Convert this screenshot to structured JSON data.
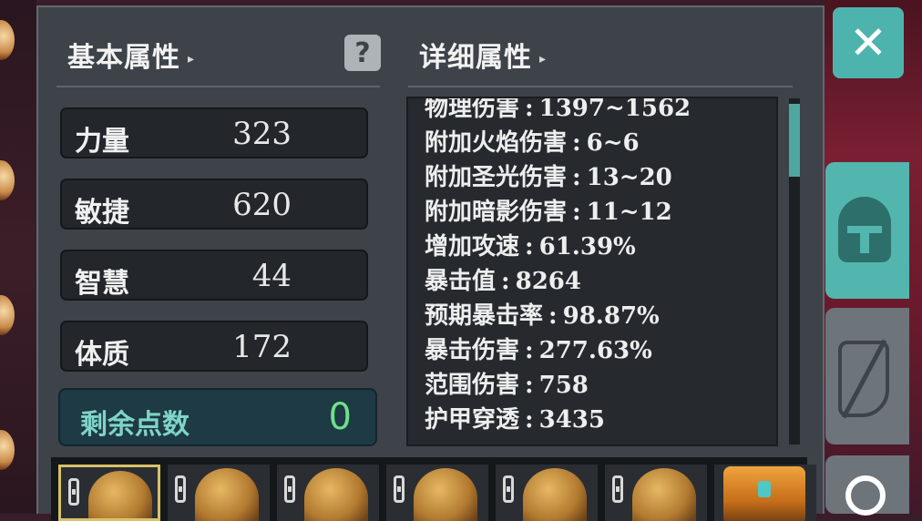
{
  "basic": {
    "title": "基本属性",
    "caret": "▸",
    "stats": [
      {
        "label": "力量",
        "value": "323"
      },
      {
        "label": "敏捷",
        "value": "620"
      },
      {
        "label": "智慧",
        "value": "44"
      },
      {
        "label": "体质",
        "value": "172"
      }
    ],
    "remaining": {
      "label": "剩余点数",
      "value": "0"
    },
    "help_glyph": "?"
  },
  "detail": {
    "title": "详细属性",
    "caret": "▸",
    "items": [
      {
        "label": "物理伤害",
        "value": "1397~1562"
      },
      {
        "label": "附加火焰伤害",
        "value": "6~6"
      },
      {
        "label": "附加圣光伤害",
        "value": "13~20"
      },
      {
        "label": "附加暗影伤害",
        "value": "11~12"
      },
      {
        "label": "增加攻速",
        "value": "61.39%"
      },
      {
        "label": "暴击值",
        "value": "8264"
      },
      {
        "label": "预期暴击率",
        "value": "98.87%"
      },
      {
        "label": "暴击伤害",
        "value": "277.63%"
      },
      {
        "label": "范围伤害",
        "value": "758"
      },
      {
        "label": "护甲穿透",
        "value": "3435"
      }
    ],
    "separator": ":"
  },
  "close_glyph": "✕",
  "equipment_slots": [
    {
      "icon": "helmet-item-icon",
      "locked": true,
      "selected": true
    },
    {
      "icon": "helmet-item-icon",
      "locked": true,
      "selected": false
    },
    {
      "icon": "helmet-item-icon",
      "locked": true,
      "selected": false
    },
    {
      "icon": "helmet-item-icon",
      "locked": true,
      "selected": false
    },
    {
      "icon": "helmet-item-icon",
      "locked": true,
      "selected": false
    },
    {
      "icon": "helmet-item-icon",
      "locked": true,
      "selected": false
    },
    {
      "icon": "chest-item-icon",
      "locked": false,
      "selected": false
    }
  ],
  "side_tabs": [
    {
      "icon": "helmet-icon",
      "active": true
    },
    {
      "icon": "gloves-icon",
      "active": false
    },
    {
      "icon": "ring-icon",
      "active": false
    }
  ],
  "colors": {
    "accent": "#4db4ad",
    "remaining_value": "#6ee08a",
    "remaining_label": "#7fd4c8"
  }
}
